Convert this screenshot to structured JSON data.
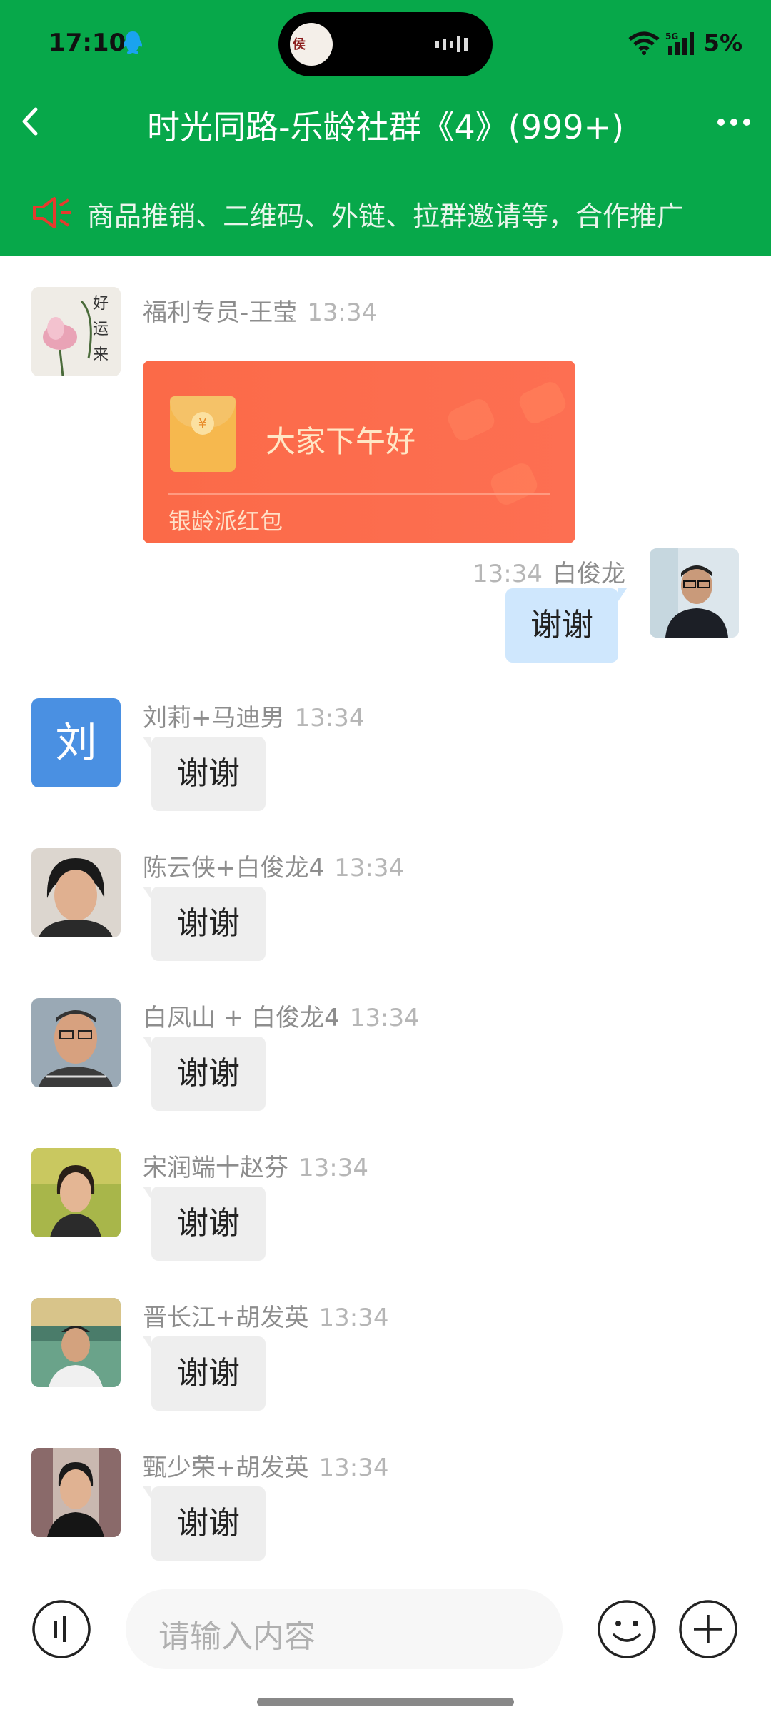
{
  "status": {
    "time": "17:10",
    "network": "5G",
    "battery": "5%"
  },
  "header": {
    "title": "时光同路-乐龄社群《4》(999+)"
  },
  "notice": {
    "text": "商品推销、二维码、外链、拉群邀请等，合作推广"
  },
  "messages": [
    {
      "sender": "福利专员-王莹",
      "time": "13:34",
      "packet_title": "大家下午好",
      "packet_label": "银龄派红包"
    },
    {
      "sender": "白俊龙",
      "time": "13:34",
      "text": "谢谢"
    },
    {
      "sender": "刘莉+马迪男",
      "time": "13:34",
      "text": "谢谢",
      "avatar_char": "刘"
    },
    {
      "sender": "陈云侠+白俊龙4",
      "time": "13:34",
      "text": "谢谢"
    },
    {
      "sender": "白凤山 + 白俊龙4",
      "time": "13:34",
      "text": "谢谢"
    },
    {
      "sender": "宋润端十赵芬",
      "time": "13:34",
      "text": "谢谢"
    },
    {
      "sender": "晋长江+胡发英",
      "time": "13:34",
      "text": "谢谢"
    },
    {
      "sender": "甄少荣+胡发英",
      "time": "13:34",
      "text": "谢谢"
    }
  ],
  "input": {
    "placeholder": "请输入内容"
  },
  "colors": {
    "header": "#07a84a",
    "packet": "#fd6f52",
    "self_bubble": "#cfe7fd",
    "other_bubble": "#eeeeee",
    "avatar_letter_bg": "#4a90e2"
  }
}
